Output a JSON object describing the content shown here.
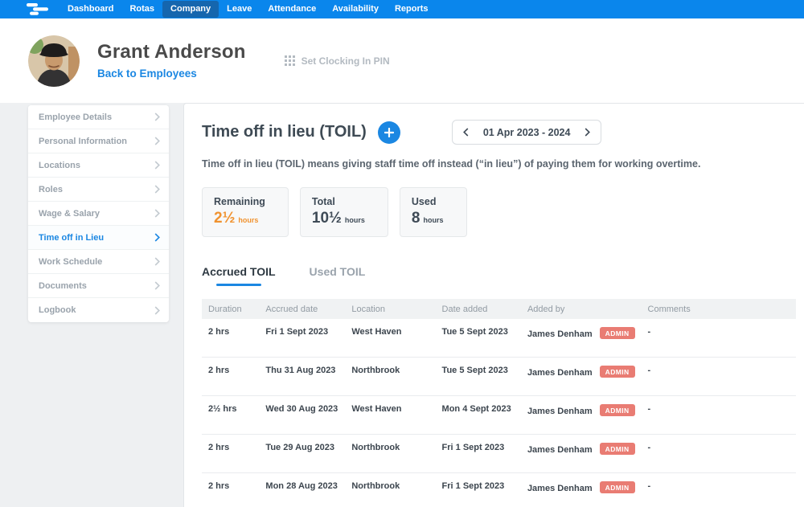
{
  "navbar": {
    "items": [
      {
        "label": "Dashboard",
        "active": false
      },
      {
        "label": "Rotas",
        "active": false
      },
      {
        "label": "Company",
        "active": true
      },
      {
        "label": "Leave",
        "active": false
      },
      {
        "label": "Attendance",
        "active": false
      },
      {
        "label": "Availability",
        "active": false
      },
      {
        "label": "Reports",
        "active": false
      }
    ]
  },
  "header": {
    "employee_name": "Grant Anderson",
    "back_link_label": "Back to Employees",
    "set_pin_label": "Set Clocking In PIN"
  },
  "sidebar": {
    "items": [
      {
        "label": "Employee Details",
        "active": false
      },
      {
        "label": "Personal Information",
        "active": false
      },
      {
        "label": "Locations",
        "active": false
      },
      {
        "label": "Roles",
        "active": false
      },
      {
        "label": "Wage & Salary",
        "active": false
      },
      {
        "label": "Time off in Lieu",
        "active": true
      },
      {
        "label": "Work Schedule",
        "active": false
      },
      {
        "label": "Documents",
        "active": false
      },
      {
        "label": "Logbook",
        "active": false
      }
    ]
  },
  "main": {
    "title": "Time off in lieu (TOIL)",
    "date_range": "01 Apr 2023 - 2024",
    "description": "Time off in lieu (TOIL) means giving staff time off instead (“in lieu”) of paying them for working overtime.",
    "stats": [
      {
        "label": "Remaining",
        "value": "2½",
        "unit": "hours",
        "highlight": true
      },
      {
        "label": "Total",
        "value": "10½",
        "unit": "hours",
        "highlight": false
      },
      {
        "label": "Used",
        "value": "8",
        "unit": "hours",
        "highlight": false
      }
    ],
    "tabs": [
      {
        "label": "Accrued TOIL",
        "active": true
      },
      {
        "label": "Used TOIL",
        "active": false
      }
    ],
    "table": {
      "columns": [
        "Duration",
        "Accrued date",
        "Location",
        "Date added",
        "Added by",
        "Comments"
      ],
      "rows": [
        {
          "duration": "2 hrs",
          "accrued_date": "Fri 1 Sept 2023",
          "location": "West Haven",
          "date_added": "Tue 5 Sept 2023",
          "added_by": "James Denham",
          "badge": "ADMIN",
          "comments": "-"
        },
        {
          "duration": "2 hrs",
          "accrued_date": "Thu 31 Aug 2023",
          "location": "Northbrook",
          "date_added": "Tue 5 Sept 2023",
          "added_by": "James Denham",
          "badge": "ADMIN",
          "comments": "-"
        },
        {
          "duration": "2½ hrs",
          "accrued_date": "Wed 30 Aug 2023",
          "location": "West Haven",
          "date_added": "Mon 4 Sept 2023",
          "added_by": "James Denham",
          "badge": "ADMIN",
          "comments": "-"
        },
        {
          "duration": "2 hrs",
          "accrued_date": "Tue 29 Aug 2023",
          "location": "Northbrook",
          "date_added": "Fri 1 Sept 2023",
          "added_by": "James Denham",
          "badge": "ADMIN",
          "comments": "-"
        },
        {
          "duration": "2 hrs",
          "accrued_date": "Mon 28 Aug 2023",
          "location": "Northbrook",
          "date_added": "Fri 1 Sept 2023",
          "added_by": "James Denham",
          "badge": "ADMIN",
          "comments": "-"
        }
      ]
    }
  },
  "colors": {
    "navbar_blue": "#0a86ec",
    "nav_active_blue": "#1566ae",
    "accent_blue": "#1b87e2",
    "highlight_orange": "#f0922f",
    "admin_badge_red": "#e97c73"
  }
}
